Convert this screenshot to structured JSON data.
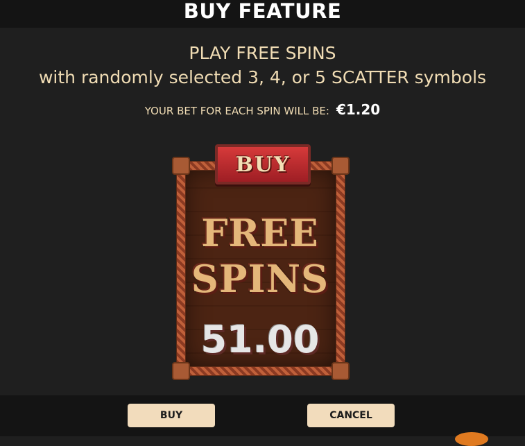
{
  "header": {
    "title": "BUY FEATURE"
  },
  "description": {
    "line1": "PLAY FREE SPINS",
    "line2": "with randomly selected 3, 4, or 5 SCATTER symbols"
  },
  "bet": {
    "label": "YOUR BET FOR EACH SPIN WILL BE:",
    "value": "€1.20"
  },
  "feature_panel": {
    "sign_label": "BUY",
    "title_line1": "FREE",
    "title_line2": "SPINS",
    "price": "51.00"
  },
  "actions": {
    "buy_label": "BUY",
    "cancel_label": "CANCEL"
  },
  "colors": {
    "accent_text": "#f0dcb4",
    "button_bg": "#f2dcbc",
    "sign_red": "#d63a3a"
  }
}
